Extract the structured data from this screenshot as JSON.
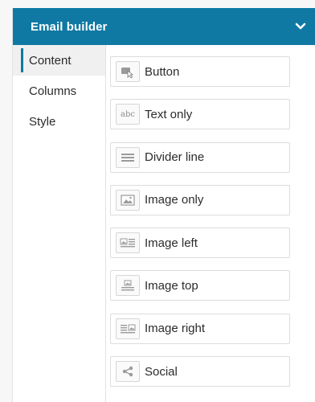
{
  "header": {
    "title": "Email builder",
    "toggle_icon": "chevron-down-icon"
  },
  "sidebar": {
    "items": [
      {
        "label": "Content",
        "active": true
      },
      {
        "label": "Columns",
        "active": false
      },
      {
        "label": "Style",
        "active": false
      }
    ]
  },
  "content_blocks": [
    {
      "label": "Button",
      "icon": "button-block-icon"
    },
    {
      "label": "Text only",
      "icon": "abc-text-icon",
      "icon_text": "abc"
    },
    {
      "label": "Divider line",
      "icon": "divider-icon"
    },
    {
      "label": "Image only",
      "icon": "image-icon"
    },
    {
      "label": "Image left",
      "icon": "image-left-icon"
    },
    {
      "label": "Image top",
      "icon": "image-top-icon"
    },
    {
      "label": "Image right",
      "icon": "image-right-icon"
    },
    {
      "label": "Social",
      "icon": "share-icon"
    }
  ],
  "colors": {
    "accent": "#0f79a3",
    "text": "#2b2b2b",
    "border": "#dcdcdc"
  }
}
